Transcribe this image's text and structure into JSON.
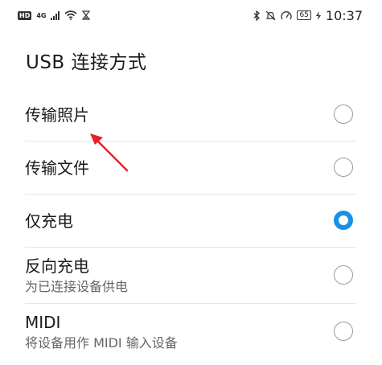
{
  "status_bar": {
    "hd": "HD",
    "network": "4G",
    "battery": "65",
    "time": "10:37"
  },
  "page": {
    "title": "USB 连接方式"
  },
  "options": [
    {
      "label": "传输照片",
      "desc": "",
      "checked": false
    },
    {
      "label": "传输文件",
      "desc": "",
      "checked": false
    },
    {
      "label": "仅充电",
      "desc": "",
      "checked": true
    },
    {
      "label": "反向充电",
      "desc": "为已连接设备供电",
      "checked": false
    },
    {
      "label": "MIDI",
      "desc": "将设备用作 MIDI 输入设备",
      "checked": false
    }
  ],
  "colors": {
    "accent": "#1a8fe3",
    "annotation_arrow": "#e0222a"
  },
  "icons": {
    "status_icons": [
      "wifi-icon",
      "hourglass-icon",
      "bluetooth-icon",
      "mute-icon",
      "speed-icon",
      "charging-icon"
    ]
  }
}
